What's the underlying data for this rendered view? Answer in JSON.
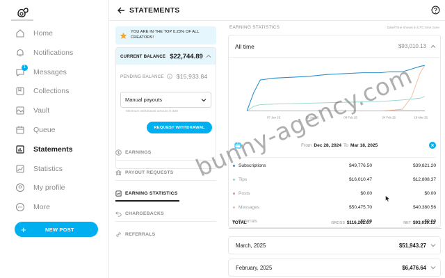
{
  "sidebar": {
    "items": [
      {
        "label": "Home",
        "icon": "home-icon"
      },
      {
        "label": "Notifications",
        "icon": "bell-icon"
      },
      {
        "label": "Messages",
        "icon": "chat-icon",
        "badge": "1"
      },
      {
        "label": "Collections",
        "icon": "bookmark-icon"
      },
      {
        "label": "Vault",
        "icon": "vault-icon"
      },
      {
        "label": "Queue",
        "icon": "calendar-icon"
      },
      {
        "label": "Statements",
        "icon": "bar-chart-icon",
        "active": true
      },
      {
        "label": "Statistics",
        "icon": "line-chart-icon"
      },
      {
        "label": "My profile",
        "icon": "user-icon"
      },
      {
        "label": "More",
        "icon": "more-icon"
      }
    ],
    "new_post": "NEW POST"
  },
  "header": {
    "title": "STATEMENTS"
  },
  "banner": {
    "text": "YOU ARE IN THE TOP 0.23% OF ALL CREATORS!"
  },
  "balance": {
    "current_label": "CURRENT BALANCE",
    "current_value": "$22,744.89",
    "pending_label": "PENDING BALANCE",
    "pending_value": "$15,933.84",
    "payout_mode": "Manual payouts",
    "min_note": "Minimum withdrawal amount is $20",
    "request_button": "REQUEST WITHDRAWAL"
  },
  "subnav": [
    {
      "label": "EARNINGS",
      "icon": "dollar-icon"
    },
    {
      "label": "PAYOUT REQUESTS",
      "icon": "bank-icon"
    },
    {
      "label": "EARNING STATISTICS",
      "icon": "stats-icon",
      "active": true
    },
    {
      "label": "CHARGEBACKS",
      "icon": "undo-icon"
    },
    {
      "label": "REFERRALS",
      "icon": "referral-icon"
    }
  ],
  "stats": {
    "title": "EARNING STATISTICS",
    "timezone_note": "Date/Time shown in UTC time zone",
    "range_label": "All time",
    "range_total": "$93,010.13",
    "from_label": "From",
    "from_date": "Dec 28, 2024",
    "to_label": "To",
    "to_date": "Mar 18, 2025",
    "rows": [
      {
        "name": "Subscriptions",
        "gross": "$49,776.50",
        "net": "$39,821.20",
        "color": "#2d8fd0"
      },
      {
        "name": "Tips",
        "gross": "$16,010.47",
        "net": "$12,808.37",
        "color": "#8fd5c9"
      },
      {
        "name": "Posts",
        "gross": "$0.00",
        "net": "$0.00",
        "color": "#f08a8a"
      },
      {
        "name": "Messages",
        "gross": "$50,475.70",
        "net": "$40,380.56",
        "color": "#f4b89a"
      },
      {
        "name": "Referrals",
        "gross": "$0.00",
        "net": "$0.00",
        "color": "#b497d6"
      }
    ],
    "total_label": "TOTAL",
    "gross_label": "GROSS",
    "gross_total": "$116,262.67",
    "net_label": "NET",
    "net_total": "$93,010.13"
  },
  "months": [
    {
      "label": "March, 2025",
      "value": "$51,943.27"
    },
    {
      "label": "February, 2025",
      "value": "$6,476.64"
    }
  ],
  "watermark": "bunny-agency.com",
  "chart_data": {
    "type": "line",
    "x_ticks": [
      "07 Jan 25",
      "23 Jan 25",
      "08 Feb 25",
      "24 Feb 25",
      "18 Mar 25"
    ],
    "x": [
      0,
      3,
      6,
      12,
      20,
      28,
      36,
      44,
      52,
      60,
      64,
      70,
      74,
      78,
      80
    ],
    "series": [
      {
        "name": "Subscriptions",
        "color": "#2d8fd0",
        "values": [
          0,
          20,
          34,
          36,
          37,
          38,
          40,
          41,
          42,
          42,
          43,
          43,
          46,
          49,
          50
        ]
      },
      {
        "name": "Tips",
        "color": "#8fd5c9",
        "values": [
          0,
          5,
          7,
          7.5,
          8,
          8.5,
          9,
          9.5,
          10,
          10.5,
          11,
          12,
          13,
          14,
          16
        ]
      },
      {
        "name": "Posts",
        "color": "#f08a8a",
        "values": [
          0,
          0,
          0,
          0,
          0,
          0,
          0,
          0,
          0,
          0,
          0,
          0,
          0,
          0,
          0
        ]
      },
      {
        "name": "Messages",
        "color": "#f4b89a",
        "values": [
          0,
          0,
          0,
          0,
          0,
          0,
          0,
          0,
          0,
          0,
          0.5,
          2,
          15,
          42,
          50
        ]
      },
      {
        "name": "Referrals",
        "color": "#b497d6",
        "values": [
          0,
          0,
          0,
          0,
          0,
          0,
          0,
          0,
          0,
          0,
          0,
          0,
          0,
          0,
          0
        ]
      }
    ],
    "ylim": [
      0,
      55
    ],
    "grid": false
  }
}
